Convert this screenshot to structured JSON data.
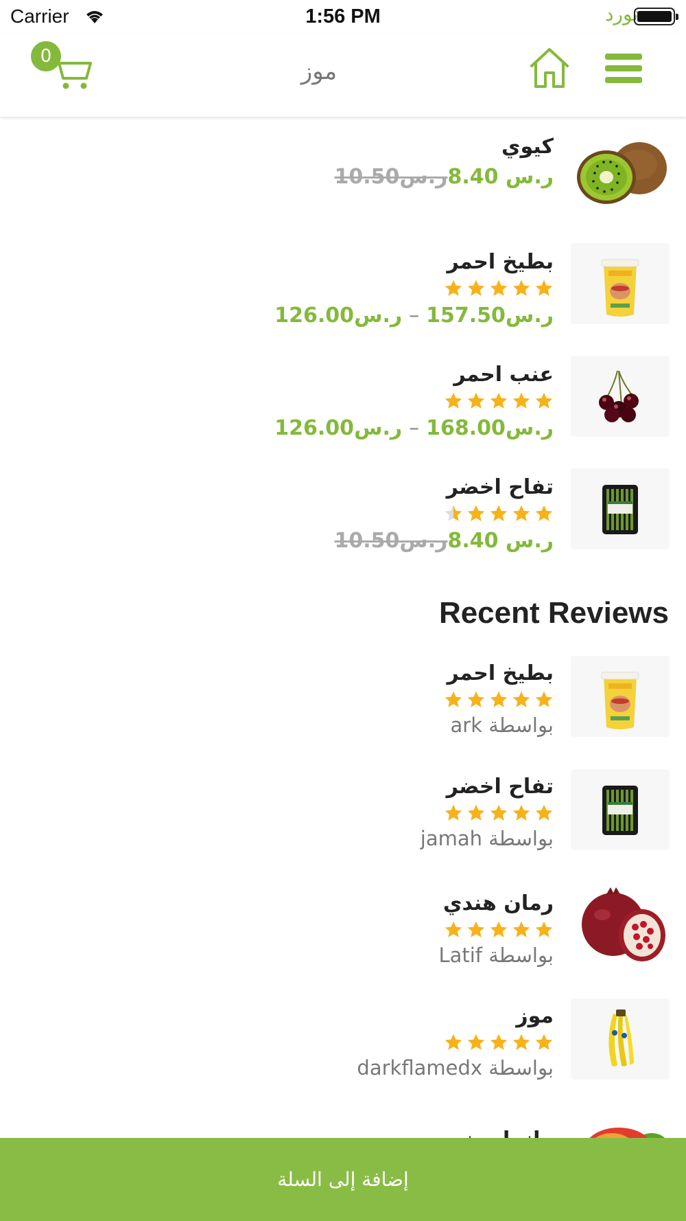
{
  "status_bar": {
    "carrier": "Carrier",
    "time": "1:56 PM",
    "brand": "تورد"
  },
  "nav": {
    "title": "موز",
    "cart_count": "0"
  },
  "products": [
    {
      "name": "كيوي",
      "old_price": "ر.س10.50",
      "price": "ر.س 8.40",
      "rating": 0,
      "image": "kiwi"
    },
    {
      "name": "بطيخ احمر",
      "price_min": "ر.س126.00",
      "price_max": "ر.س157.50",
      "rating": 5,
      "image": "buttermilk"
    },
    {
      "name": "عنب احمر",
      "price_min": "ر.س126.00",
      "price_max": "ر.س168.00",
      "rating": 5,
      "image": "cherries"
    },
    {
      "name": "تفاح اخضر",
      "old_price": "ر.س10.50",
      "price": "ر.س 8.40",
      "rating": 4.5,
      "image": "asparagus"
    }
  ],
  "reviews_title": "Recent Reviews",
  "reviews": [
    {
      "name": "بطيخ احمر",
      "by": "بواسطة ark",
      "rating": 5,
      "image": "buttermilk"
    },
    {
      "name": "تفاح اخضر",
      "by": "بواسطة jamah",
      "rating": 5,
      "image": "asparagus"
    },
    {
      "name": "رمان هندي",
      "by": "بواسطة Latif",
      "rating": 5,
      "image": "pomegranate"
    },
    {
      "name": "موز",
      "by": "بواسطة darkflamedx",
      "rating": 5,
      "image": "banana"
    },
    {
      "name": "مانجا يمني",
      "image": "mango"
    }
  ],
  "bottom_button": "إضافة إلى السلة",
  "colors": {
    "accent": "#84b93b",
    "button_bg": "#89bc45",
    "star": "#f7b21a",
    "star_empty": "#dcdcdc"
  }
}
